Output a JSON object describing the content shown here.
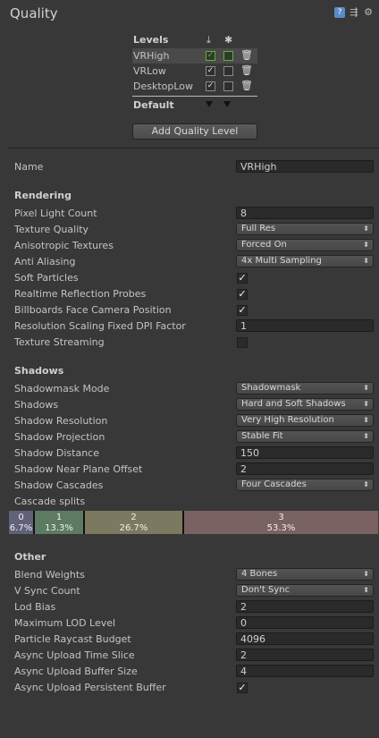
{
  "window": {
    "title": "Quality",
    "icons": [
      "help-book-icon",
      "preset-icon",
      "settings-gear-icon"
    ]
  },
  "levels": {
    "header": "Levels",
    "platform_icons": [
      "pc-download-icon",
      "android-icon"
    ],
    "rows": [
      {
        "name": "VRHigh",
        "pc": true,
        "android": false,
        "selected": true
      },
      {
        "name": "VRLow",
        "pc": true,
        "android": false,
        "selected": false
      },
      {
        "name": "DesktopLow",
        "pc": true,
        "android": false,
        "selected": false
      }
    ],
    "default_label": "Default",
    "add_button": "Add Quality Level"
  },
  "name_row": {
    "label": "Name",
    "value": "VRHigh"
  },
  "rendering": {
    "title": "Rendering",
    "pixel_light_count": {
      "label": "Pixel Light Count",
      "value": "8"
    },
    "texture_quality": {
      "label": "Texture Quality",
      "value": "Full Res"
    },
    "anisotropic": {
      "label": "Anisotropic Textures",
      "value": "Forced On"
    },
    "anti_aliasing": {
      "label": "Anti Aliasing",
      "value": "4x Multi Sampling"
    },
    "soft_particles": {
      "label": "Soft Particles",
      "checked": true
    },
    "realtime_reflection": {
      "label": "Realtime Reflection Probes",
      "checked": true
    },
    "billboards": {
      "label": "Billboards Face Camera Position",
      "checked": true
    },
    "resolution_scaling": {
      "label": "Resolution Scaling Fixed DPI Factor",
      "value": "1"
    },
    "texture_streaming": {
      "label": "Texture Streaming",
      "checked": false
    }
  },
  "shadows": {
    "title": "Shadows",
    "shadowmask_mode": {
      "label": "Shadowmask Mode",
      "value": "Shadowmask"
    },
    "shadows": {
      "label": "Shadows",
      "value": "Hard and Soft Shadows"
    },
    "resolution": {
      "label": "Shadow Resolution",
      "value": "Very High Resolution"
    },
    "projection": {
      "label": "Shadow Projection",
      "value": "Stable Fit"
    },
    "distance": {
      "label": "Shadow Distance",
      "value": "150"
    },
    "near_plane": {
      "label": "Shadow Near Plane Offset",
      "value": "2"
    },
    "cascades": {
      "label": "Shadow Cascades",
      "value": "Four Cascades"
    },
    "cascade_splits": {
      "label": "Cascade splits",
      "segments": [
        {
          "index": "0",
          "percent": "6.7%",
          "fraction": 0.067,
          "color": "#61617a"
        },
        {
          "index": "1",
          "percent": "13.3%",
          "fraction": 0.133,
          "color": "#5d7a62"
        },
        {
          "index": "2",
          "percent": "26.7%",
          "fraction": 0.267,
          "color": "#7b7a60"
        },
        {
          "index": "3",
          "percent": "53.3%",
          "fraction": 0.533,
          "color": "#7a6262"
        }
      ]
    }
  },
  "other": {
    "title": "Other",
    "blend_weights": {
      "label": "Blend Weights",
      "value": "4 Bones"
    },
    "vsync": {
      "label": "V Sync Count",
      "value": "Don't Sync"
    },
    "lod_bias": {
      "label": "Lod Bias",
      "value": "2"
    },
    "max_lod": {
      "label": "Maximum LOD Level",
      "value": "0"
    },
    "particle_raycast": {
      "label": "Particle Raycast Budget",
      "value": "4096"
    },
    "async_time_slice": {
      "label": "Async Upload Time Slice",
      "value": "2"
    },
    "async_buffer_size": {
      "label": "Async Upload Buffer Size",
      "value": "4"
    },
    "async_persistent": {
      "label": "Async Upload Persistent Buffer",
      "checked": true
    }
  },
  "colors": {
    "background": "#383838",
    "field": "#2a2a2a",
    "accent_green": "#5cb03c"
  }
}
